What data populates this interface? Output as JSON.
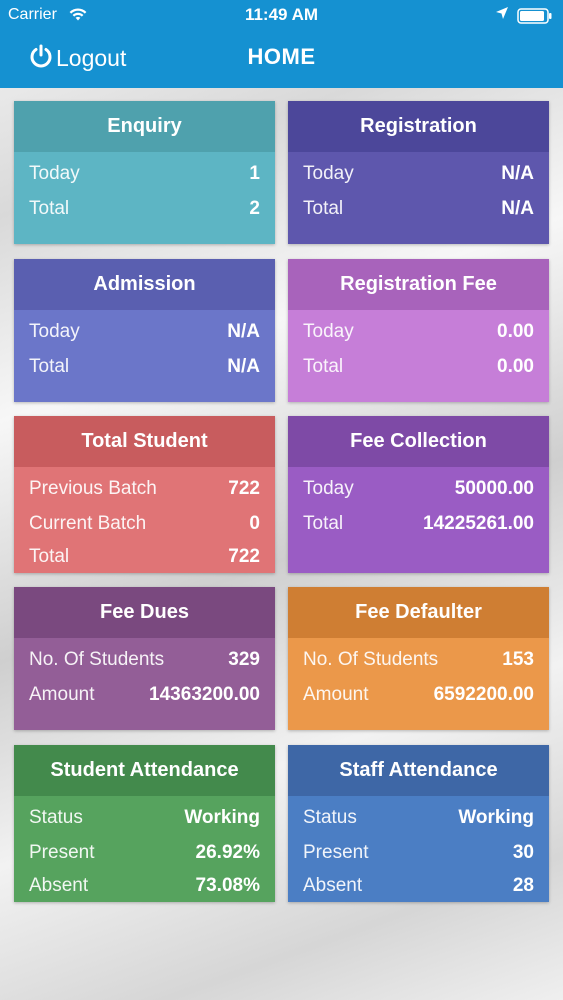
{
  "status_bar": {
    "carrier": "Carrier",
    "time": "11:49 AM"
  },
  "nav": {
    "logout_label": "Logout",
    "title": "HOME"
  },
  "cards": [
    {
      "title": "Enquiry",
      "head_color": "#4fa1ad",
      "body_color": "#5db5c4",
      "rows": [
        {
          "label": "Today",
          "value": "1"
        },
        {
          "label": "Total",
          "value": "2"
        }
      ]
    },
    {
      "title": "Registration",
      "head_color": "#4c479a",
      "body_color": "#5e57ad",
      "rows": [
        {
          "label": "Today",
          "value": "N/A"
        },
        {
          "label": "Total",
          "value": "N/A"
        }
      ]
    },
    {
      "title": "Admission",
      "head_color": "#5a5fb0",
      "body_color": "#6b76c9",
      "rows": [
        {
          "label": "Today",
          "value": "N/A"
        },
        {
          "label": "Total",
          "value": "N/A"
        }
      ]
    },
    {
      "title": "Registration Fee",
      "head_color": "#a863bb",
      "body_color": "#c67ed8",
      "rows": [
        {
          "label": "Today",
          "value": "0.00"
        },
        {
          "label": "Total",
          "value": "0.00"
        }
      ]
    },
    {
      "title": "Total Student",
      "head_color": "#c85c5e",
      "body_color": "#e07476",
      "rows": [
        {
          "label": "Previous Batch",
          "value": "722"
        },
        {
          "label": "Current Batch",
          "value": "0"
        },
        {
          "label": "Total",
          "value": "722"
        }
      ]
    },
    {
      "title": "Fee Collection",
      "head_color": "#7e4aa6",
      "body_color": "#9a5cc4",
      "rows": [
        {
          "label": "Today",
          "value": "50000.00"
        },
        {
          "label": "Total",
          "value": "14225261.00"
        }
      ]
    },
    {
      "title": "Fee Dues",
      "head_color": "#7a497f",
      "body_color": "#935e97",
      "rows": [
        {
          "label": "No. Of Students",
          "value": "329"
        },
        {
          "label": "Amount",
          "value": "14363200.00"
        }
      ]
    },
    {
      "title": "Fee Defaulter",
      "head_color": "#cf7e33",
      "body_color": "#eb984a",
      "rows": [
        {
          "label": "No. Of Students",
          "value": "153"
        },
        {
          "label": "Amount",
          "value": "6592200.00"
        }
      ]
    },
    {
      "title": "Student Attendance",
      "head_color": "#438a4c",
      "body_color": "#56a35e",
      "rows": [
        {
          "label": "Status",
          "value": "Working"
        },
        {
          "label": "Present",
          "value": "26.92%"
        },
        {
          "label": "Absent",
          "value": "73.08%"
        }
      ]
    },
    {
      "title": "Staff Attendance",
      "head_color": "#3e67a6",
      "body_color": "#4b7ec4",
      "rows": [
        {
          "label": "Status",
          "value": "Working"
        },
        {
          "label": "Present",
          "value": "30"
        },
        {
          "label": "Absent",
          "value": "28"
        }
      ]
    }
  ]
}
